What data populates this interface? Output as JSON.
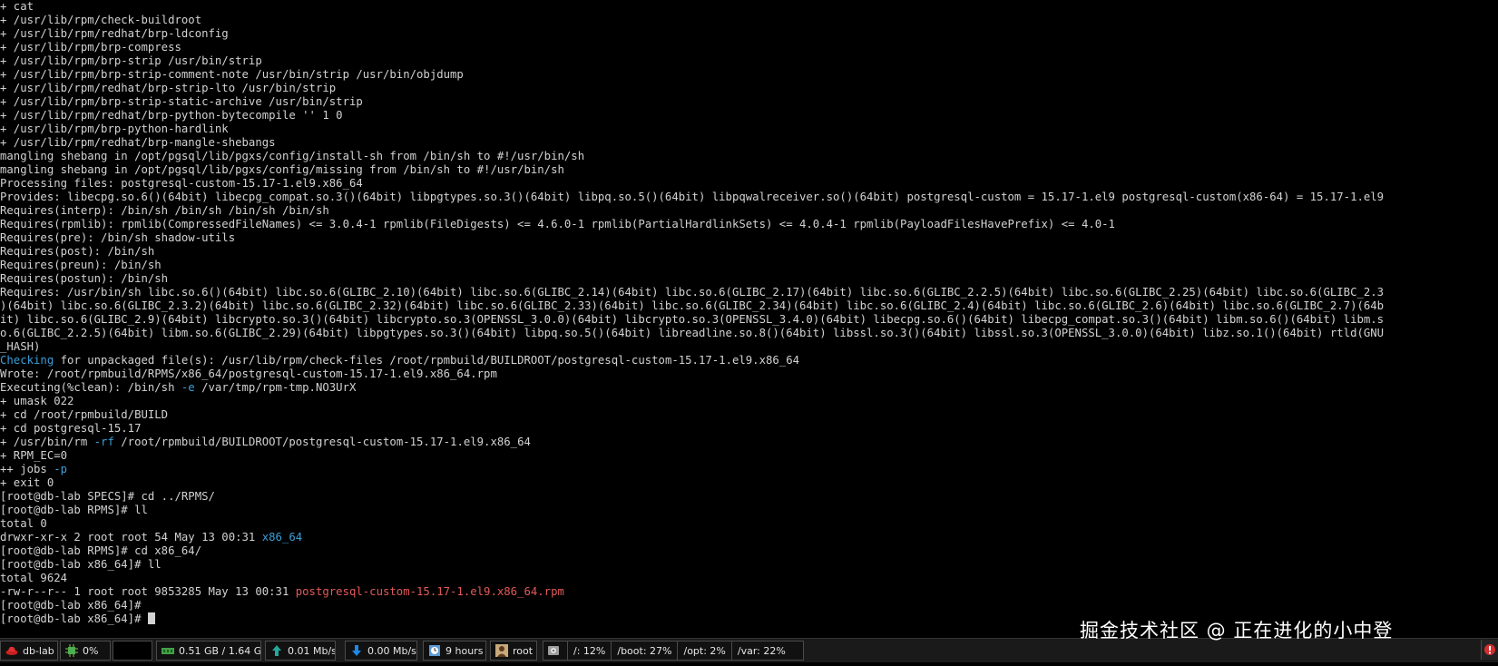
{
  "terminal": {
    "lines": [
      [
        {
          "t": "+ cat",
          "c": "white"
        }
      ],
      [
        {
          "t": "+ /usr/lib/rpm/check-buildroot",
          "c": "white"
        }
      ],
      [
        {
          "t": "+ /usr/lib/rpm/redhat/brp-ldconfig",
          "c": "white"
        }
      ],
      [
        {
          "t": "+ /usr/lib/rpm/brp-compress",
          "c": "white"
        }
      ],
      [
        {
          "t": "+ /usr/lib/rpm/brp-strip /usr/bin/strip",
          "c": "white"
        }
      ],
      [
        {
          "t": "+ /usr/lib/rpm/brp-strip-comment-note /usr/bin/strip /usr/bin/objdump",
          "c": "white"
        }
      ],
      [
        {
          "t": "+ /usr/lib/rpm/redhat/brp-strip-lto /usr/bin/strip",
          "c": "white"
        }
      ],
      [
        {
          "t": "+ /usr/lib/rpm/brp-strip-static-archive /usr/bin/strip",
          "c": "white"
        }
      ],
      [
        {
          "t": "+ /usr/lib/rpm/redhat/brp-python-bytecompile '' 1 0",
          "c": "white"
        }
      ],
      [
        {
          "t": "+ /usr/lib/rpm/brp-python-hardlink",
          "c": "white"
        }
      ],
      [
        {
          "t": "+ /usr/lib/rpm/redhat/brp-mangle-shebangs",
          "c": "white"
        }
      ],
      [
        {
          "t": "mangling shebang in /opt/pgsql/lib/pgxs/config/install-sh from /bin/sh to #!/usr/bin/sh",
          "c": "white"
        }
      ],
      [
        {
          "t": "mangling shebang in /opt/pgsql/lib/pgxs/config/missing from /bin/sh to #!/usr/bin/sh",
          "c": "white"
        }
      ],
      [
        {
          "t": "Processing files: postgresql-custom-15.17-1.el9.x86_64",
          "c": "white"
        }
      ],
      [
        {
          "t": "Provides: libecpg.so.6()(64bit) libecpg_compat.so.3()(64bit) libpgtypes.so.3()(64bit) libpq.so.5()(64bit) libpqwalreceiver.so()(64bit) postgresql-custom = 15.17-1.el9 postgresql-custom(x86-64) = 15.17-1.el9",
          "c": "white"
        }
      ],
      [
        {
          "t": "Requires(interp): /bin/sh /bin/sh /bin/sh /bin/sh",
          "c": "white"
        }
      ],
      [
        {
          "t": "Requires(rpmlib): rpmlib(CompressedFileNames) <= 3.0.4-1 rpmlib(FileDigests) <= 4.6.0-1 rpmlib(PartialHardlinkSets) <= 4.0.4-1 rpmlib(PayloadFilesHavePrefix) <= 4.0-1",
          "c": "white"
        }
      ],
      [
        {
          "t": "Requires(pre): /bin/sh shadow-utils",
          "c": "white"
        }
      ],
      [
        {
          "t": "Requires(post): /bin/sh",
          "c": "white"
        }
      ],
      [
        {
          "t": "Requires(preun): /bin/sh",
          "c": "white"
        }
      ],
      [
        {
          "t": "Requires(postun): /bin/sh",
          "c": "white"
        }
      ],
      [
        {
          "t": "Requires: /usr/bin/sh libc.so.6()(64bit) libc.so.6(GLIBC_2.10)(64bit) libc.so.6(GLIBC_2.14)(64bit) libc.so.6(GLIBC_2.17)(64bit) libc.so.6(GLIBC_2.2.5)(64bit) libc.so.6(GLIBC_2.25)(64bit) libc.so.6(GLIBC_2.3",
          "c": "white"
        }
      ],
      [
        {
          "t": ")(64bit) libc.so.6(GLIBC_2.3.2)(64bit) libc.so.6(GLIBC_2.32)(64bit) libc.so.6(GLIBC_2.33)(64bit) libc.so.6(GLIBC_2.34)(64bit) libc.so.6(GLIBC_2.4)(64bit) libc.so.6(GLIBC_2.6)(64bit) libc.so.6(GLIBC_2.7)(64b",
          "c": "white"
        }
      ],
      [
        {
          "t": "it) libc.so.6(GLIBC_2.9)(64bit) libcrypto.so.3()(64bit) libcrypto.so.3(OPENSSL_3.0.0)(64bit) libcrypto.so.3(OPENSSL_3.4.0)(64bit) libecpg.so.6()(64bit) libecpg_compat.so.3()(64bit) libm.so.6()(64bit) libm.s",
          "c": "white"
        }
      ],
      [
        {
          "t": "o.6(GLIBC_2.2.5)(64bit) libm.so.6(GLIBC_2.29)(64bit) libpgtypes.so.3()(64bit) libpq.so.5()(64bit) libreadline.so.8()(64bit) libssl.so.3()(64bit) libssl.so.3(OPENSSL_3.0.0)(64bit) libz.so.1()(64bit) rtld(GNU",
          "c": "white"
        }
      ],
      [
        {
          "t": "_HASH)",
          "c": "white"
        }
      ],
      [
        {
          "t": "Checking",
          "c": "cyan"
        },
        {
          "t": " for unpackaged file(s): /usr/lib/rpm/check-files /root/rpmbuild/BUILDROOT/postgresql-custom-15.17-1.el9.x86_64",
          "c": "white"
        }
      ],
      [
        {
          "t": "Wrote: /root/rpmbuild/RPMS/x86_64/postgresql-custom-15.17-1.el9.x86_64.rpm",
          "c": "white"
        }
      ],
      [
        {
          "t": "Executing(%clean): /bin/sh ",
          "c": "white"
        },
        {
          "t": "-e",
          "c": "cyan"
        },
        {
          "t": " /var/tmp/rpm-tmp.NO3UrX",
          "c": "white"
        }
      ],
      [
        {
          "t": "+ umask 022",
          "c": "white"
        }
      ],
      [
        {
          "t": "+ cd /root/rpmbuild/BUILD",
          "c": "white"
        }
      ],
      [
        {
          "t": "+ cd postgresql-15.17",
          "c": "white"
        }
      ],
      [
        {
          "t": "+ /usr/bin/rm ",
          "c": "white"
        },
        {
          "t": "-rf",
          "c": "cyan"
        },
        {
          "t": " /root/rpmbuild/BUILDROOT/postgresql-custom-15.17-1.el9.x86_64",
          "c": "white"
        }
      ],
      [
        {
          "t": "+ RPM_EC=0",
          "c": "white"
        }
      ],
      [
        {
          "t": "++ jobs ",
          "c": "white"
        },
        {
          "t": "-p",
          "c": "cyan"
        }
      ],
      [
        {
          "t": "+ exit 0",
          "c": "white"
        }
      ],
      [
        {
          "t": "[root@db-lab SPECS]# cd ../RPMS/",
          "c": "white"
        }
      ],
      [
        {
          "t": "[root@db-lab RPMS]# ll",
          "c": "white"
        }
      ],
      [
        {
          "t": "total 0",
          "c": "white"
        }
      ],
      [
        {
          "t": "drwxr-xr-x 2 root root 54 May 13 00:31 ",
          "c": "white"
        },
        {
          "t": "x86_64",
          "c": "cyan"
        }
      ],
      [
        {
          "t": "[root@db-lab RPMS]# cd x86_64/",
          "c": "white"
        }
      ],
      [
        {
          "t": "[root@db-lab x86_64]# ll",
          "c": "white"
        }
      ],
      [
        {
          "t": "total 9624",
          "c": "white"
        }
      ],
      [
        {
          "t": "-rw-r--r-- 1 root root 9853285 May 13 00:31 ",
          "c": "white"
        },
        {
          "t": "postgresql-custom-15.17-1.el9.x86_64.rpm",
          "c": "red"
        }
      ],
      [
        {
          "t": "[root@db-lab x86_64]#",
          "c": "white"
        }
      ],
      [
        {
          "t": "[root@db-lab x86_64]# ",
          "c": "white"
        },
        {
          "t": "",
          "c": "cursor"
        }
      ]
    ]
  },
  "statusbar": {
    "host": "db-lab",
    "cpu": "0%",
    "memory": "0.51 GB / 1.64 GB",
    "upload": "0.01 Mb/s",
    "download": "0.00 Mb/s",
    "uptime": "9 hours",
    "user": "root",
    "disk_root": "/: 12%",
    "disk_boot": "/boot: 27%",
    "disk_opt": "/opt: 2%",
    "disk_var": "/var: 22%"
  },
  "colors": {
    "text": "#d2d2d2",
    "cyan": "#3a9fd8",
    "red": "#e25a5a",
    "background": "#000000"
  },
  "watermark": "掘金技术社区 @ 正在进化的小中登"
}
